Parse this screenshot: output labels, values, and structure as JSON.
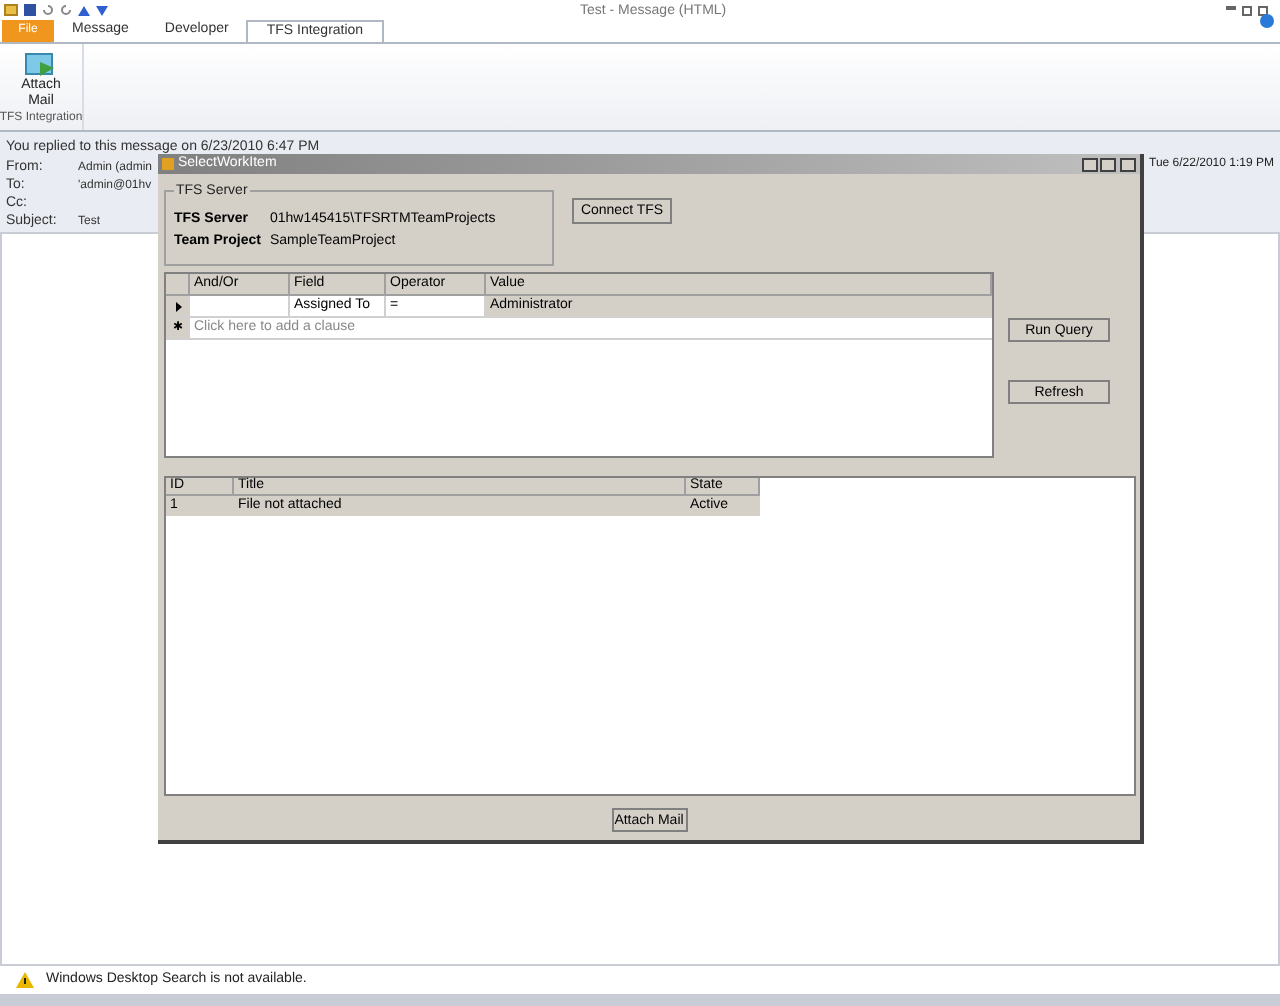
{
  "window": {
    "title": "Test - Message (HTML)"
  },
  "ribbon_tabs": [
    {
      "label": "File",
      "kind": "file",
      "selected": false
    },
    {
      "label": "Message",
      "kind": "tab",
      "selected": false
    },
    {
      "label": "Developer",
      "kind": "tab",
      "selected": false
    },
    {
      "label": "TFS Integration",
      "kind": "tab",
      "selected": true
    }
  ],
  "ribbon": {
    "button": "Attach\nMail",
    "group": "TFS Integration"
  },
  "header": {
    "info": "You replied to this message on 6/23/2010 6:47 PM",
    "fields": [
      {
        "label": "From:",
        "value": "Admin (admin"
      },
      {
        "label": "To:",
        "value": "'admin@01hv"
      },
      {
        "label": "Cc:"
      },
      {
        "label": "Subject:",
        "value": "Test"
      }
    ],
    "sent": "Tue 6/22/2010 1:19 PM"
  },
  "dialog": {
    "title": "SelectWorkItem",
    "group_title": "TFS Server",
    "server_label": "TFS Server",
    "server": "01hw145415\\TFSRTMTeamProjects",
    "project_label": "Team Project",
    "project": "SampleTeamProject",
    "connect": "Connect TFS",
    "query_columns": [
      "And/Or",
      "Field",
      "Operator",
      "Value"
    ],
    "query_rows": [
      {
        "current": true,
        "cells": [
          "",
          "Assigned To",
          "=",
          "Administrator"
        ]
      }
    ],
    "new_row": {
      "marker": "✱",
      "hint": "Click here to add a clause"
    },
    "run": "Run Query",
    "refresh": "Refresh",
    "result_columns": [
      "ID",
      "Title",
      "State"
    ],
    "result_rows": [
      {
        "selected": true,
        "cells": [
          "1",
          "File not attached",
          "Active"
        ]
      }
    ],
    "attach": "Attach Mail"
  },
  "status_bar": {
    "message": "Windows Desktop Search is not available."
  }
}
